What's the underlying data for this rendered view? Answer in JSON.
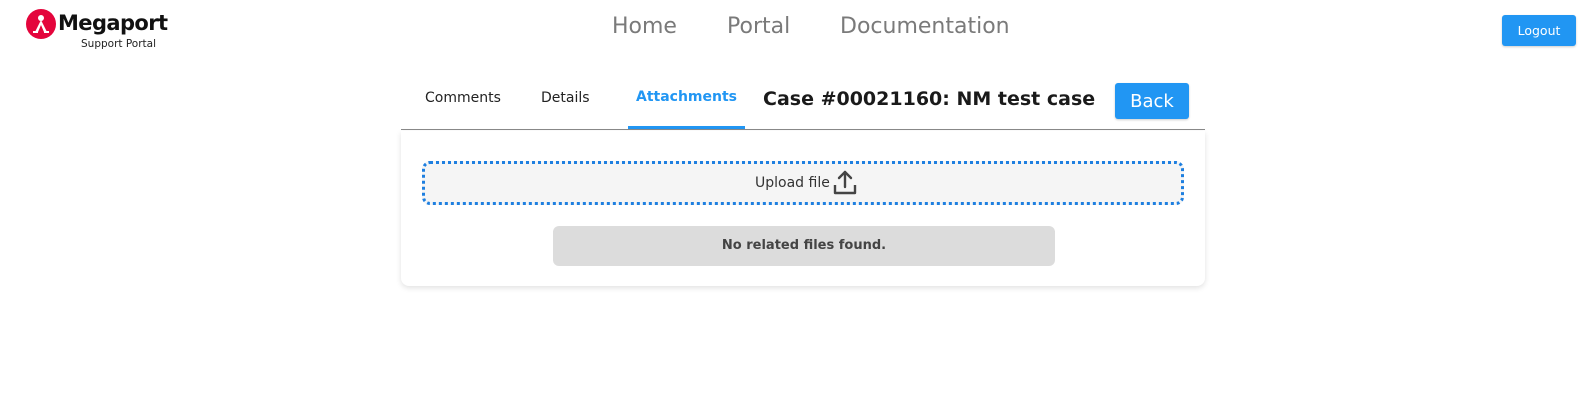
{
  "brand": {
    "name": "Megaport",
    "subtitle": "Support Portal",
    "color": "#e4053c"
  },
  "nav": {
    "items": [
      {
        "label": "Home"
      },
      {
        "label": "Portal"
      },
      {
        "label": "Documentation"
      }
    ],
    "logout_label": "Logout"
  },
  "case": {
    "tabs": [
      {
        "label": "Comments",
        "active": false
      },
      {
        "label": "Details",
        "active": false
      },
      {
        "label": "Attachments",
        "active": true
      }
    ],
    "title": "Case #00021160: NM test case",
    "back_label": "Back"
  },
  "attachments": {
    "upload_label": "Upload file",
    "upload_icon": "upload-icon",
    "empty_message": "No related files found."
  },
  "colors": {
    "accent": "#2196f3",
    "upload_border": "#1e7fe0",
    "empty_bg": "#dcdcdc"
  }
}
